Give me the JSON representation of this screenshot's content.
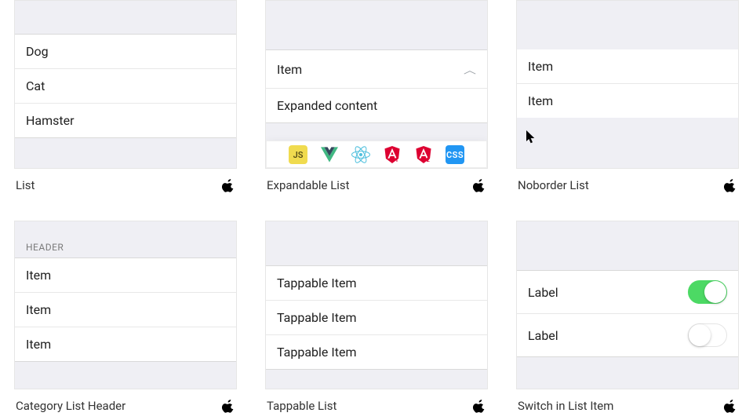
{
  "cards": {
    "list": {
      "caption": "List",
      "items": [
        "Dog",
        "Cat",
        "Hamster"
      ]
    },
    "expandable": {
      "caption": "Expandable List",
      "header_item": "Item",
      "expanded_content": "Expanded content"
    },
    "noborder": {
      "caption": "Noborder List",
      "items": [
        "Item",
        "Item"
      ]
    },
    "category": {
      "caption": "Category List Header",
      "header": "HEADER",
      "items": [
        "Item",
        "Item",
        "Item"
      ]
    },
    "tappable": {
      "caption": "Tappable List",
      "items": [
        "Tappable Item",
        "Tappable Item",
        "Tappable Item"
      ]
    },
    "switch": {
      "caption": "Switch in List Item",
      "rows": [
        {
          "label": "Label",
          "on": true
        },
        {
          "label": "Label",
          "on": false
        }
      ]
    }
  },
  "toolbar": {
    "js": "JS",
    "css": "CSS",
    "icons": [
      "vue-icon",
      "react-icon",
      "angular1-icon",
      "angular2-icon"
    ]
  }
}
